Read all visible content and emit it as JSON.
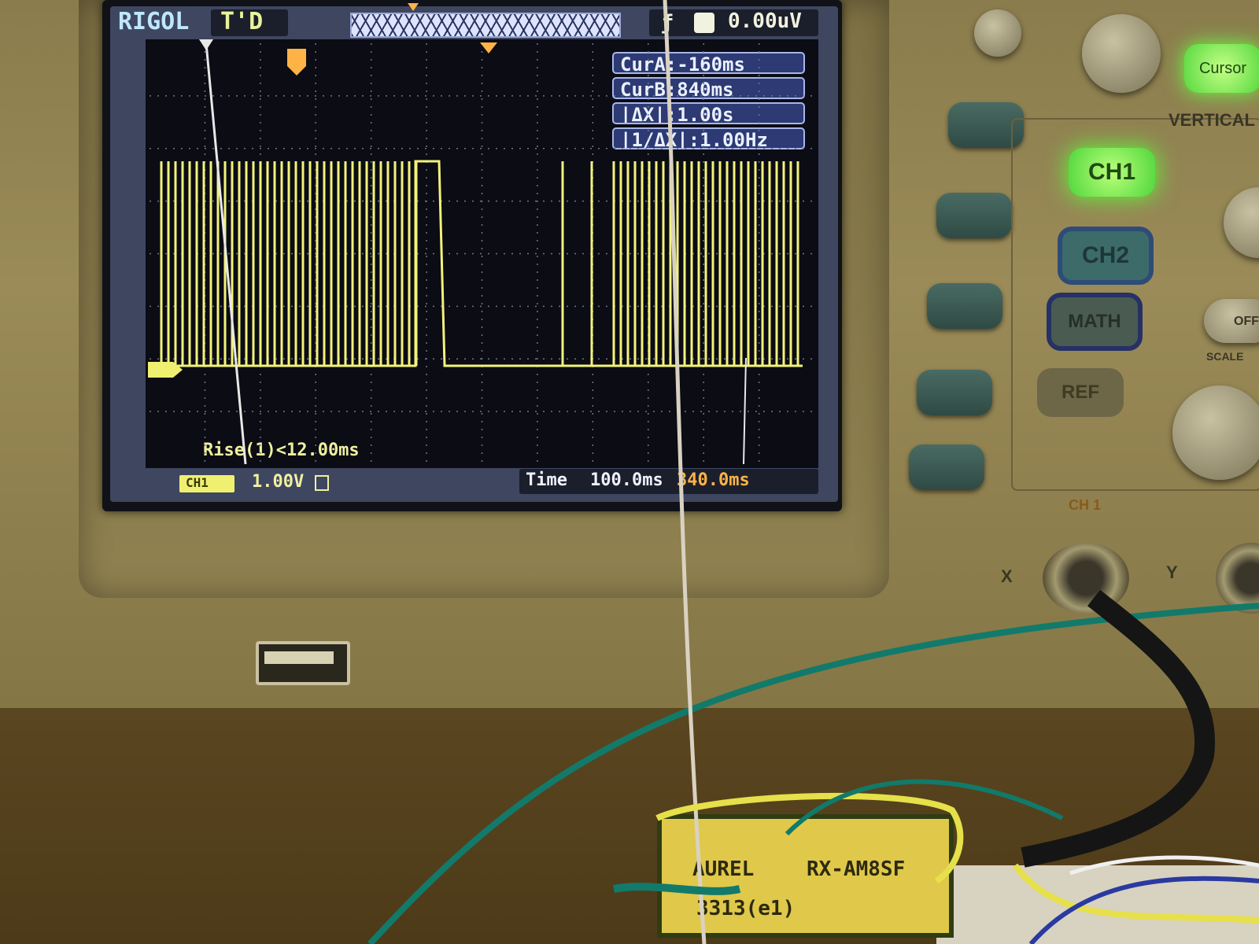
{
  "scope": {
    "brand": "RIGOL",
    "trigger_status": "T'D",
    "trigger_level": "0.00uV",
    "cursors": {
      "cur_a": "CurA:-160ms",
      "cur_b": "CurB:840ms",
      "delta_x": "|ΔX|:1.00s",
      "inv_delta_x": "|1/ΔX|:1.00Hz"
    },
    "measurement": "Rise(1)<12.00ms",
    "channel_badge": "CH1",
    "volts_per_div": "1.00V",
    "time_label": "Time",
    "time_per_div": "100.0ms",
    "trigger_delay": "340.0ms",
    "trace_color": "#f2f27a"
  },
  "panel": {
    "cursor_button": "Cursor",
    "vertical_label": "VERTICAL",
    "ch1_button": "CH1",
    "ch2_button": "CH2",
    "math_button": "MATH",
    "ref_button": "REF",
    "scale_label": "SCALE",
    "off_label": "OFF",
    "ch1_connector_label": "CH 1",
    "x_label": "X",
    "y_label": "Y"
  },
  "board": {
    "line1a": "AUREL",
    "line1b": "RX-AM8SF",
    "line2": "3313(e1)"
  },
  "colors": {
    "ch1_active": "#5eff3a",
    "screen_bg": "#0b0c14",
    "cursor_box": "#2d3a73"
  }
}
